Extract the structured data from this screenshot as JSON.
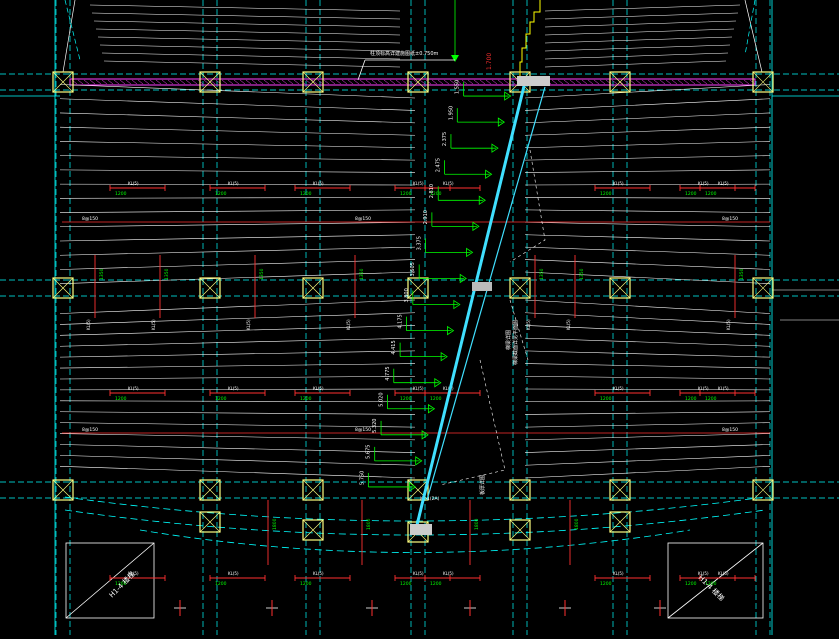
{
  "drawing": {
    "top_note": "柱顶标高详建施图纸±0.750m",
    "beam_label": "KL-1(2A)",
    "beam_label_alt": "KL(5)",
    "beam_rebar_label": "3Φ25",
    "slab_rebar_label": "8@150",
    "rebar_length": "1200",
    "rebar_length_side": "1350",
    "rebar_length_side2": "1800",
    "step_elevations": [
      "1.550",
      "1.950",
      "2.375",
      "2.475",
      "2.810",
      "2.910",
      "3.375",
      "3.605",
      "3.800",
      "4.175",
      "4.415",
      "4.775",
      "5.020",
      "5.320",
      "5.675",
      "5.750"
    ],
    "elevation_red": "1.700",
    "vertical_note_1": "梯梁详图",
    "vertical_note_2": "梯梁截面详见平面图",
    "vertical_note_3": "板厚详图",
    "corner_left": "H1-4 楼梯",
    "corner_right": "H1-4 楼梯"
  },
  "colors": {
    "background": "#000000",
    "column_fill": "#ffff80",
    "beam_line": "#00ffff",
    "rebar_red": "#ff3030",
    "dim_green": "#00ff00",
    "stair_cyan": "#40e0ff",
    "magenta": "#ff40ff",
    "text_white": "#ffffff",
    "text_yellow": "#ffff00"
  }
}
